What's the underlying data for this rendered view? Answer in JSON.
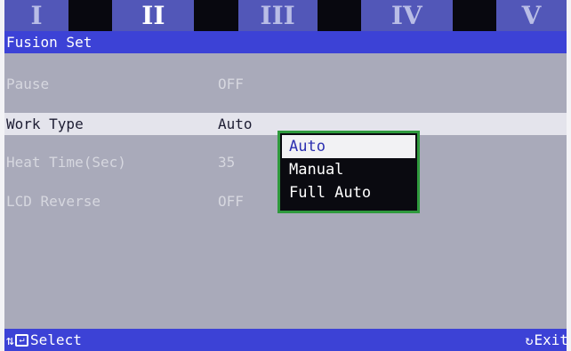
{
  "tabs": [
    {
      "label": "I",
      "active": false
    },
    {
      "label": "II",
      "active": true
    },
    {
      "label": "III",
      "active": false
    },
    {
      "label": "IV",
      "active": false
    },
    {
      "label": "V",
      "active": false
    }
  ],
  "header": {
    "title": "Fusion Set"
  },
  "settings": [
    {
      "label": "Pause",
      "value": "OFF",
      "selected": false
    },
    {
      "label": "Work Type",
      "value": "Auto",
      "selected": true
    },
    {
      "label": "Heat Time(Sec)",
      "value": "35",
      "selected": false
    },
    {
      "label": "LCD Reverse",
      "value": "OFF",
      "selected": false
    }
  ],
  "dropdown": {
    "options": [
      "Auto",
      "Manual",
      "Full Auto"
    ],
    "selected": "Auto"
  },
  "footer": {
    "select_label": "Select",
    "exit_label": "Exit",
    "icons": [
      "up-down-arrows-icon",
      "enter-icon",
      "refresh-icon"
    ]
  },
  "colors": {
    "tab_bar": "#5257b8",
    "header": "#3c42d6",
    "body": "#a9aaba",
    "selected_row": "#e4e4ec",
    "dropdown_border": "#2f9a3d"
  }
}
